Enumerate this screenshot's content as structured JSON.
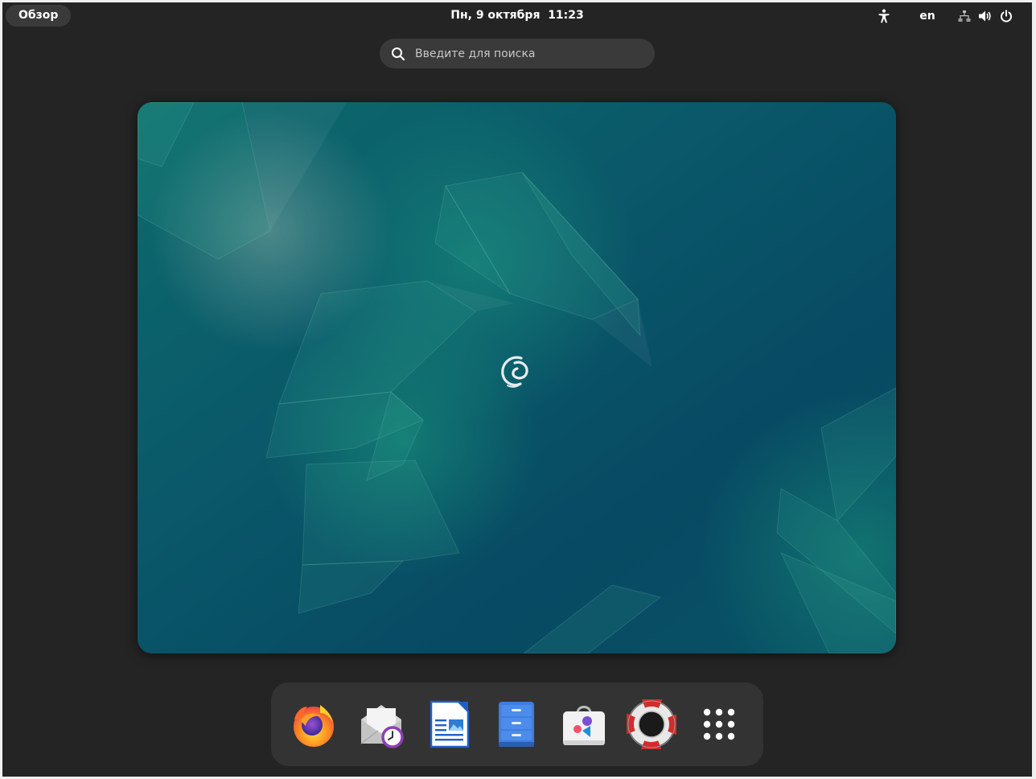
{
  "topbar": {
    "activities_label": "Обзор",
    "clock_text": "Пн, 9 октября  11:23",
    "language": "en",
    "icons": [
      "accessibility-icon",
      "network-wired-icon",
      "volume-icon",
      "power-icon"
    ]
  },
  "search": {
    "placeholder": "Введите для поиска",
    "value": ""
  },
  "workspace": {
    "wallpaper": "debian-emerald",
    "logo": "debian-swirl-icon"
  },
  "dash": {
    "items": [
      {
        "name": "firefox",
        "icon": "firefox-icon"
      },
      {
        "name": "evolution",
        "icon": "mail-clock-icon"
      },
      {
        "name": "libreoffice-writer",
        "icon": "writer-document-icon"
      },
      {
        "name": "files",
        "icon": "file-cabinet-icon"
      },
      {
        "name": "software",
        "icon": "software-store-icon"
      },
      {
        "name": "help",
        "icon": "lifebuoy-icon"
      },
      {
        "name": "show-apps",
        "icon": "app-grid-icon"
      }
    ]
  },
  "colors": {
    "panel_bg": "#242424",
    "pill_bg": "#3a3a3a",
    "dash_bg": "#333333",
    "wallpaper_base": "#07485f",
    "wallpaper_accent": "#1b8a78"
  }
}
